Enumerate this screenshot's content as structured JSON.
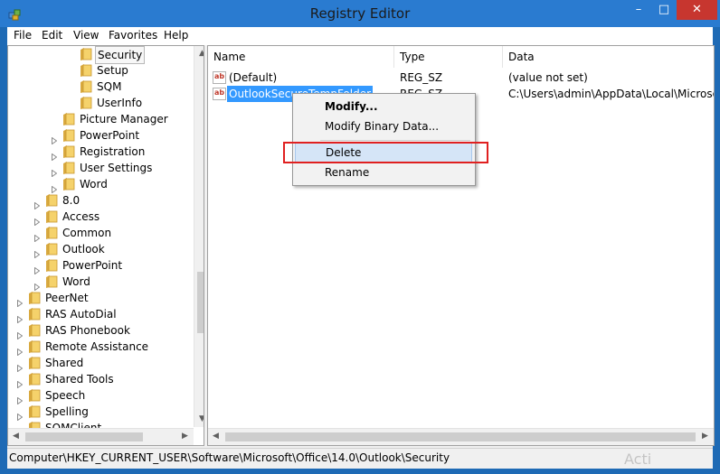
{
  "window": {
    "title": "Registry Editor",
    "minimize_glyph": "–",
    "maximize_glyph": "□",
    "close_glyph": "✕"
  },
  "menu": [
    "File",
    "Edit",
    "View",
    "Favorites",
    "Help"
  ],
  "tree": {
    "items": [
      {
        "label": "Security",
        "level": 3,
        "has_children": false,
        "selected": true
      },
      {
        "label": "Setup",
        "level": 3,
        "has_children": false
      },
      {
        "label": "SQM",
        "level": 3,
        "has_children": false
      },
      {
        "label": "UserInfo",
        "level": 3,
        "has_children": false
      },
      {
        "label": "Picture Manager",
        "level": 2,
        "has_children": false
      },
      {
        "label": "PowerPoint",
        "level": 2,
        "has_children": true
      },
      {
        "label": "Registration",
        "level": 2,
        "has_children": true
      },
      {
        "label": "User Settings",
        "level": 2,
        "has_children": true
      },
      {
        "label": "Word",
        "level": 2,
        "has_children": true
      },
      {
        "label": "8.0",
        "level": 1,
        "has_children": true
      },
      {
        "label": "Access",
        "level": 1,
        "has_children": true
      },
      {
        "label": "Common",
        "level": 1,
        "has_children": true
      },
      {
        "label": "Outlook",
        "level": 1,
        "has_children": true
      },
      {
        "label": "PowerPoint",
        "level": 1,
        "has_children": true
      },
      {
        "label": "Word",
        "level": 1,
        "has_children": true
      },
      {
        "label": "PeerNet",
        "level": 0,
        "has_children": true
      },
      {
        "label": "RAS AutoDial",
        "level": 0,
        "has_children": true
      },
      {
        "label": "RAS Phonebook",
        "level": 0,
        "has_children": true
      },
      {
        "label": "Remote Assistance",
        "level": 0,
        "has_children": true
      },
      {
        "label": "Shared",
        "level": 0,
        "has_children": true
      },
      {
        "label": "Shared Tools",
        "level": 0,
        "has_children": true
      },
      {
        "label": "Speech",
        "level": 0,
        "has_children": true
      },
      {
        "label": "Spelling",
        "level": 0,
        "has_children": true
      },
      {
        "label": "SQMClient",
        "level": 0,
        "has_children": true
      }
    ]
  },
  "list": {
    "columns": [
      "Name",
      "Type",
      "Data"
    ],
    "rows": [
      {
        "name": "(Default)",
        "type": "REG_SZ",
        "data": "(value not set)",
        "selected": false
      },
      {
        "name": "OutlookSecureTempFolder",
        "type": "REG_SZ",
        "data": "C:\\Users\\admin\\AppData\\Local\\Microsoft\\",
        "selected": true
      }
    ]
  },
  "context_menu": {
    "items": [
      {
        "label": "Modify...",
        "bold": true
      },
      {
        "label": "Modify Binary Data..."
      },
      {
        "label": "Delete",
        "hover": true
      },
      {
        "label": "Rename"
      }
    ]
  },
  "status": {
    "path": "Computer\\HKEY_CURRENT_USER\\Software\\Microsoft\\Office\\14.0\\Outlook\\Security"
  },
  "watermark": {
    "text": "Acti"
  },
  "colors": {
    "title_bar": "#2a7bd0",
    "close": "#c7362f",
    "selection": "#3399ff",
    "highlight_box": "#e02020"
  }
}
